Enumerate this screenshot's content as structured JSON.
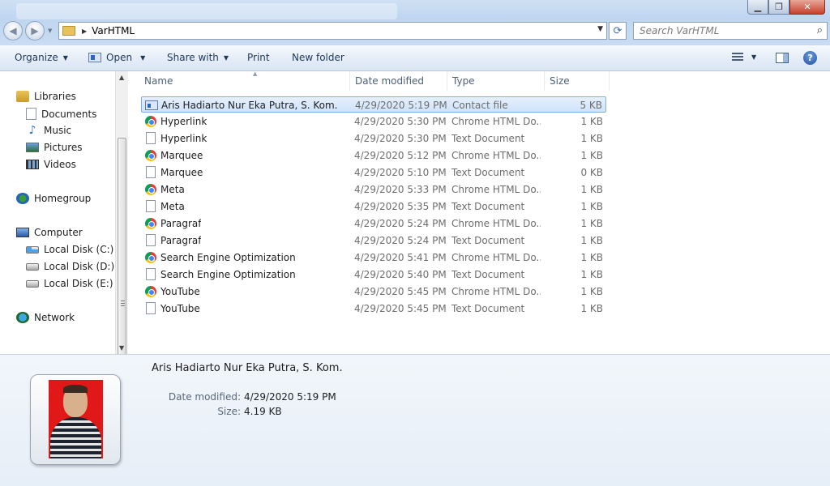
{
  "address": {
    "path": "VarHTML"
  },
  "search": {
    "placeholder": "Search VarHTML"
  },
  "toolbar": {
    "organize": "Organize",
    "open": "Open",
    "share_with": "Share with",
    "print": "Print",
    "new_folder": "New folder"
  },
  "sidebar": {
    "libraries": "Libraries",
    "documents": "Documents",
    "music": "Music",
    "pictures": "Pictures",
    "videos": "Videos",
    "homegroup": "Homegroup",
    "computer": "Computer",
    "disk_c": "Local Disk (C:)",
    "disk_d": "Local Disk (D:)",
    "disk_e": "Local Disk (E:)",
    "network": "Network"
  },
  "columns": {
    "name": "Name",
    "date": "Date modified",
    "type": "Type",
    "size": "Size"
  },
  "files": [
    {
      "name": "Aris Hadiarto Nur Eka Putra, S. Kom.",
      "date": "4/29/2020 5:19 PM",
      "type": "Contact file",
      "size": "5 KB",
      "icon": "contact-icon"
    },
    {
      "name": "Hyperlink",
      "date": "4/29/2020 5:30 PM",
      "type": "Chrome HTML Do...",
      "size": "1 KB",
      "icon": "chrome-icon"
    },
    {
      "name": "Hyperlink",
      "date": "4/29/2020 5:30 PM",
      "type": "Text Document",
      "size": "1 KB",
      "icon": "text-document-icon"
    },
    {
      "name": "Marquee",
      "date": "4/29/2020 5:12 PM",
      "type": "Chrome HTML Do...",
      "size": "1 KB",
      "icon": "chrome-icon"
    },
    {
      "name": "Marquee",
      "date": "4/29/2020 5:10 PM",
      "type": "Text Document",
      "size": "0 KB",
      "icon": "text-document-icon"
    },
    {
      "name": "Meta",
      "date": "4/29/2020 5:33 PM",
      "type": "Chrome HTML Do...",
      "size": "1 KB",
      "icon": "chrome-icon"
    },
    {
      "name": "Meta",
      "date": "4/29/2020 5:35 PM",
      "type": "Text Document",
      "size": "1 KB",
      "icon": "text-document-icon"
    },
    {
      "name": "Paragraf",
      "date": "4/29/2020 5:24 PM",
      "type": "Chrome HTML Do...",
      "size": "1 KB",
      "icon": "chrome-icon"
    },
    {
      "name": "Paragraf",
      "date": "4/29/2020 5:24 PM",
      "type": "Text Document",
      "size": "1 KB",
      "icon": "text-document-icon"
    },
    {
      "name": "Search Engine Optimization",
      "date": "4/29/2020 5:41 PM",
      "type": "Chrome HTML Do...",
      "size": "1 KB",
      "icon": "chrome-icon"
    },
    {
      "name": "Search Engine Optimization",
      "date": "4/29/2020 5:40 PM",
      "type": "Text Document",
      "size": "1 KB",
      "icon": "text-document-icon"
    },
    {
      "name": "YouTube",
      "date": "4/29/2020 5:45 PM",
      "type": "Chrome HTML Do...",
      "size": "1 KB",
      "icon": "chrome-icon"
    },
    {
      "name": "YouTube",
      "date": "4/29/2020 5:45 PM",
      "type": "Text Document",
      "size": "1 KB",
      "icon": "text-document-icon"
    }
  ],
  "details": {
    "title": "Aris Hadiarto Nur Eka Putra, S. Kom.",
    "date_label": "Date modified:",
    "date_value": "4/29/2020 5:19 PM",
    "size_label": "Size:",
    "size_value": "4.19 KB"
  },
  "colors": {
    "selection": "#cfe3fb",
    "selection_border": "#84acdd",
    "photo_bg": "#e01818"
  }
}
